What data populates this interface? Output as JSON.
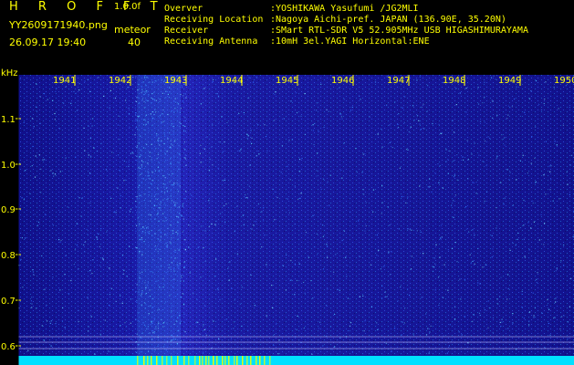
{
  "header": {
    "brand": "H R O F F T",
    "version": "1.0.0f",
    "filename": "YY2609171940.png",
    "meteor_label": "meteor",
    "datetime": "26.09.17 19:40",
    "meteor_count": "40",
    "info": [
      {
        "key": "Overver",
        "value": ":YOSHIKAWA Yasufumi /JG2MLI"
      },
      {
        "key": "Receiving Location",
        "value": ":Nagoya Aichi-pref. JAPAN (136.90E, 35.20N)"
      },
      {
        "key": "Receiver",
        "value": ":SMart RTL-SDR V5 52.905MHz USB HIGASHIMURAYAMA"
      },
      {
        "key": "Receiving Antenna",
        "value": ":10mH 3el.YAGI Horizontal:ENE"
      }
    ]
  },
  "axis": {
    "unit": "kHz",
    "y_ticks": [
      "1.1",
      "1.0",
      "0.9",
      "0.8",
      "0.7",
      "0.6"
    ],
    "x_ticks": [
      "1941",
      "1942",
      "1943",
      "1944",
      "1945",
      "1946",
      "1947",
      "1948",
      "1949",
      "1950"
    ]
  },
  "colors": {
    "text": "#ffff00",
    "background": "#000000",
    "spectrum_base": "#14149a",
    "spectrum_bright": "#3dc8ff",
    "bottom_band": "#00e8ff"
  }
}
